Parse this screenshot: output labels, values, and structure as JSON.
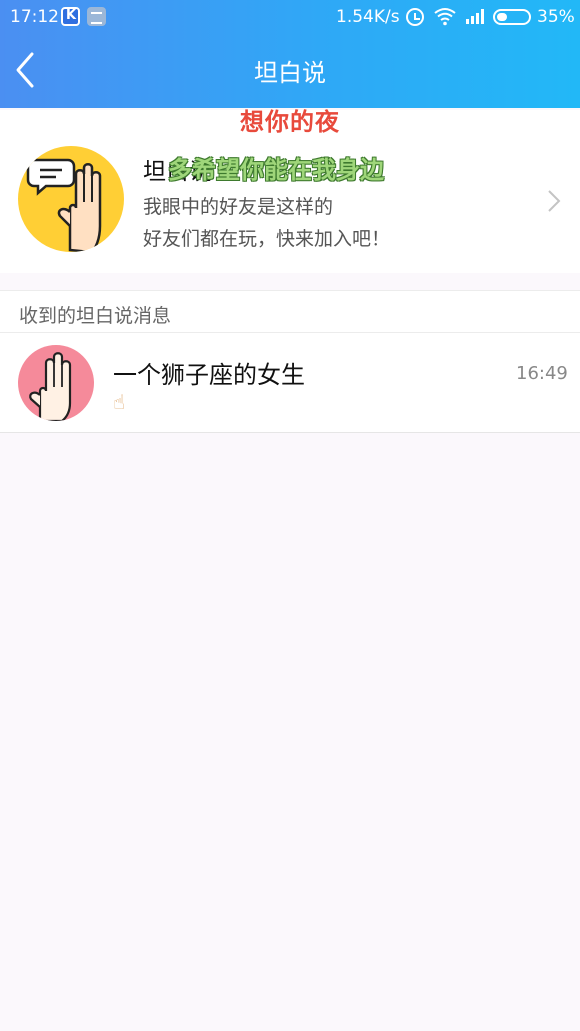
{
  "status_bar": {
    "time": "17:12",
    "network_speed": "1.54K/s",
    "battery": "35%",
    "icons": [
      "k-app-icon",
      "notes-app-icon",
      "alarm-icon",
      "wifi-icon",
      "signal-icon",
      "battery-icon"
    ]
  },
  "header": {
    "title": "坦白说",
    "back_icon": "chevron-left-icon",
    "gradient": [
      "#4b8ff2",
      "#22b8f7"
    ]
  },
  "overlays": {
    "red_text": "想你的夜",
    "green_text": "多希望你能在我身边"
  },
  "feature_card": {
    "title": "坦白说",
    "desc_line1": "我眼中的好友是这样的",
    "desc_line2": "好友们都在玩，快来加入吧！",
    "avatar_icon": "speech-bubble-hand-icon",
    "avatar_color": "#ffcf35",
    "chevron_icon": "chevron-right-icon"
  },
  "section": {
    "label": "收到的坦白说消息"
  },
  "messages": [
    {
      "name": "一个狮子座的女生",
      "preview": "☝",
      "time": "16:49",
      "avatar_icon": "hand-icon",
      "avatar_color": "#f58a9a"
    }
  ]
}
